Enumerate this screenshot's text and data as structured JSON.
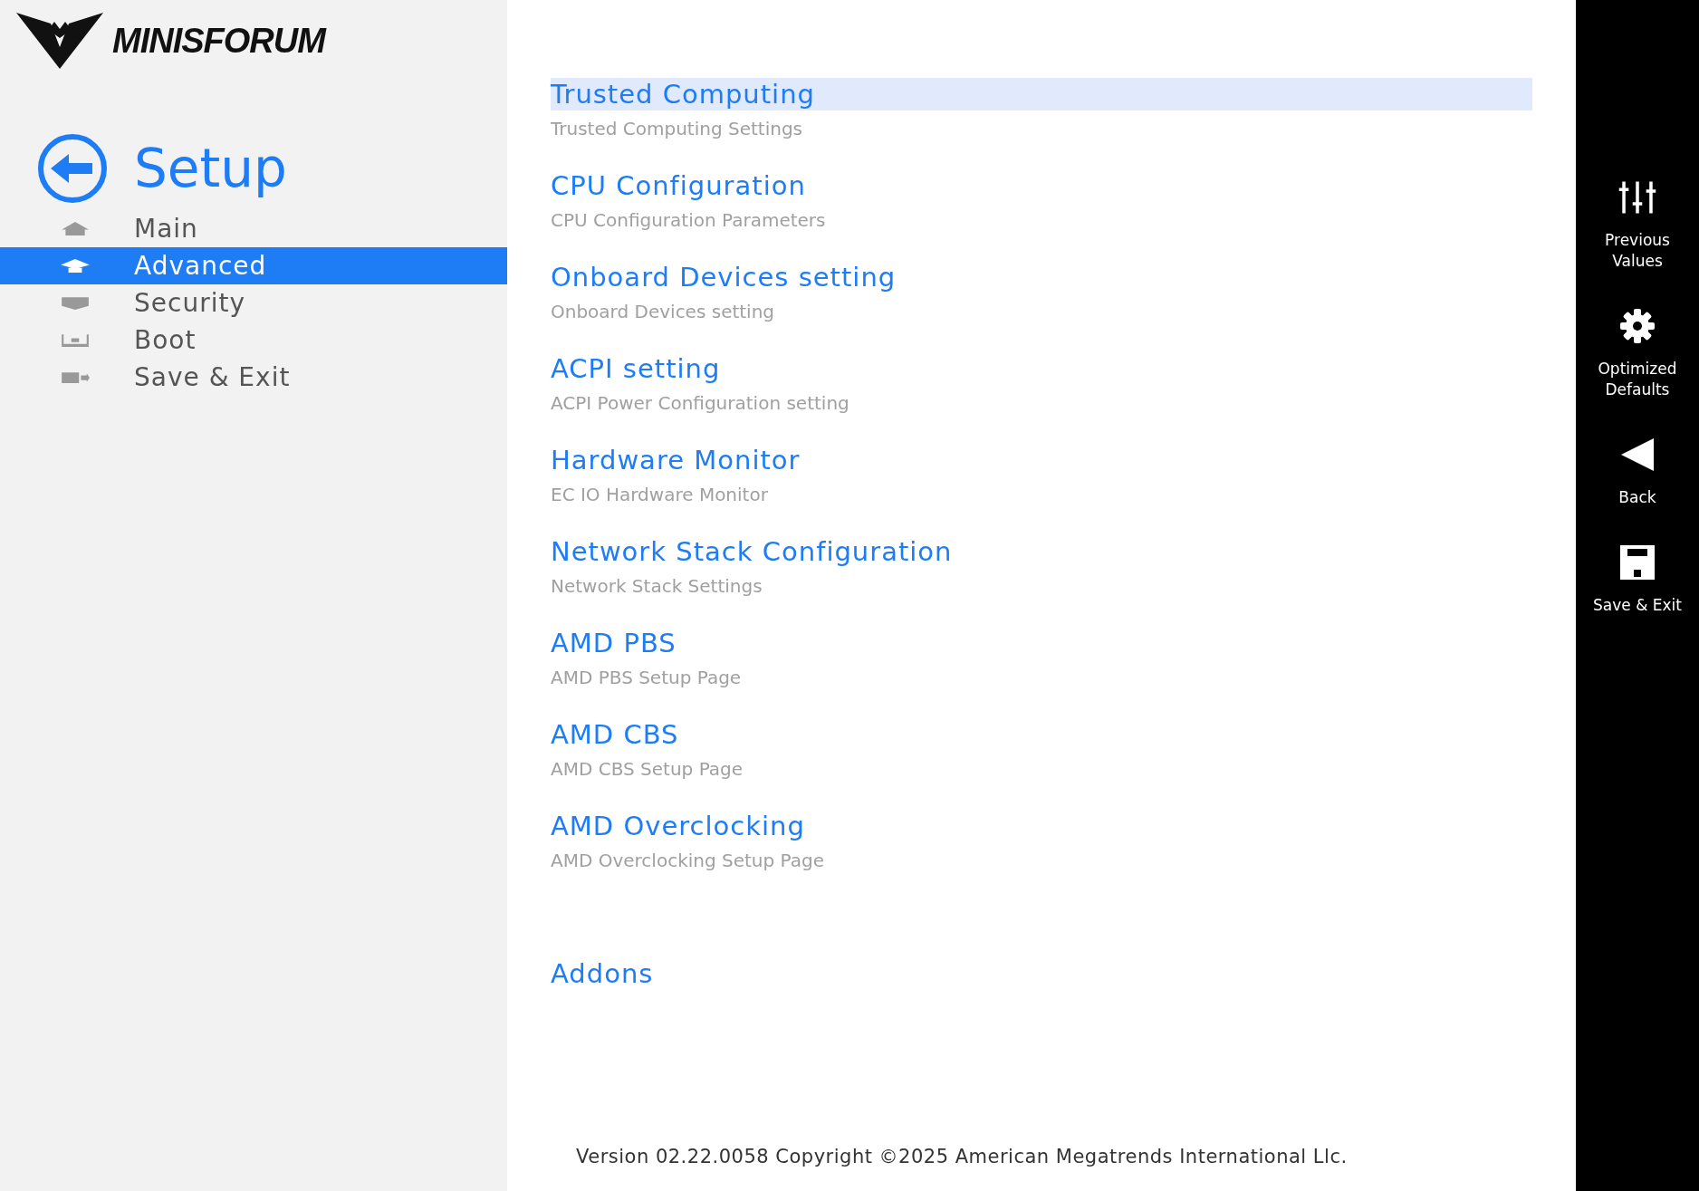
{
  "logo": {
    "wordmark": "MINISFORUM"
  },
  "sidebar": {
    "title": "Setup",
    "items": [
      {
        "label": "Main",
        "kind": "home",
        "selected": false
      },
      {
        "label": "Advanced",
        "kind": "cap",
        "selected": true
      },
      {
        "label": "Security",
        "kind": "shield",
        "selected": false
      },
      {
        "label": "Boot",
        "kind": "boot",
        "selected": false
      },
      {
        "label": "Save & Exit",
        "kind": "exit",
        "selected": false
      }
    ]
  },
  "menu": {
    "items": [
      {
        "kind": "entry",
        "title": "Trusted Computing",
        "description": "Trusted Computing Settings",
        "selected": true
      },
      {
        "kind": "entry",
        "title": "CPU Configuration",
        "description": "CPU Configuration Parameters",
        "selected": false
      },
      {
        "kind": "entry",
        "title": "Onboard Devices setting",
        "description": "Onboard Devices setting",
        "selected": false
      },
      {
        "kind": "entry",
        "title": "ACPI setting",
        "description": "ACPI Power Configuration setting",
        "selected": false
      },
      {
        "kind": "entry",
        "title": "Hardware Monitor",
        "description": "EC IO Hardware Monitor",
        "selected": false
      },
      {
        "kind": "entry",
        "title": "Network Stack Configuration",
        "description": "Network Stack Settings",
        "selected": false
      },
      {
        "kind": "entry",
        "title": "AMD PBS",
        "description": "AMD PBS Setup Page",
        "selected": false
      },
      {
        "kind": "entry",
        "title": "AMD CBS",
        "description": "AMD CBS Setup Page",
        "selected": false
      },
      {
        "kind": "entry",
        "title": "AMD Overclocking",
        "description": "AMD Overclocking Setup Page",
        "selected": false
      },
      {
        "kind": "group",
        "title": "Addons",
        "selected": false
      }
    ]
  },
  "footer": "Version 02.22.0058 Copyright ©2025 American Megatrends International Llc.",
  "actions": [
    {
      "kind": "sliders",
      "label": "Previous Values"
    },
    {
      "kind": "gear",
      "label": "Optimized Defaults"
    },
    {
      "kind": "back",
      "label": "Back"
    },
    {
      "kind": "save",
      "label": "Save & Exit"
    }
  ]
}
